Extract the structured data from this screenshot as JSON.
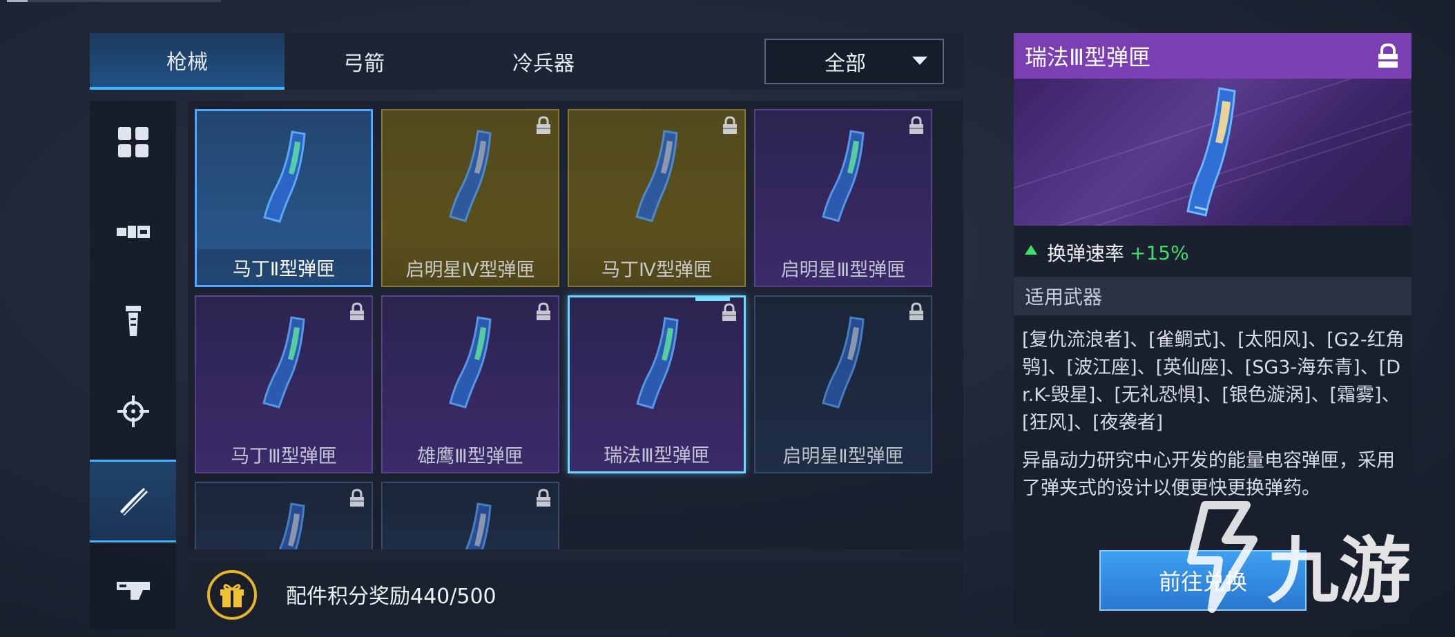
{
  "tabs": [
    {
      "label": "枪械",
      "active": true
    },
    {
      "label": "弓箭",
      "active": false
    },
    {
      "label": "冷兵器",
      "active": false
    }
  ],
  "filter": {
    "selected": "全部"
  },
  "sidebar": {
    "items": [
      {
        "icon": "grid-all-icon",
        "active": false
      },
      {
        "icon": "muzzle-icon",
        "active": false
      },
      {
        "icon": "grip-icon",
        "active": false
      },
      {
        "icon": "crosshair-scope-icon",
        "active": false
      },
      {
        "icon": "magazine-icon",
        "active": true
      },
      {
        "icon": "stock-icon",
        "active": false
      }
    ]
  },
  "grid": {
    "cards": [
      {
        "name": "马丁Ⅱ型弹匣",
        "rarity": "blue",
        "locked": false,
        "selected": false
      },
      {
        "name": "启明星Ⅳ型弹匣",
        "rarity": "gold",
        "locked": true,
        "selected": false
      },
      {
        "name": "马丁Ⅳ型弹匣",
        "rarity": "gold",
        "locked": true,
        "selected": false
      },
      {
        "name": "启明星Ⅲ型弹匣",
        "rarity": "purple",
        "locked": true,
        "selected": false
      },
      {
        "name": "马丁Ⅲ型弹匣",
        "rarity": "purple",
        "locked": true,
        "selected": false
      },
      {
        "name": "雄鹰Ⅲ型弹匣",
        "rarity": "purple",
        "locked": true,
        "selected": false
      },
      {
        "name": "瑞法Ⅲ型弹匣",
        "rarity": "purple",
        "locked": true,
        "selected": true
      },
      {
        "name": "启明星Ⅱ型弹匣",
        "rarity": "navy",
        "locked": true,
        "selected": false
      },
      {
        "name": "",
        "rarity": "navy",
        "locked": true,
        "selected": false
      },
      {
        "name": "",
        "rarity": "navy",
        "locked": true,
        "selected": false
      }
    ]
  },
  "reward": {
    "text": "配件积分奖励440/500"
  },
  "detail": {
    "title": "瑞法Ⅲ型弹匣",
    "locked": true,
    "stat_label": "换弹速率",
    "stat_value": "+15%",
    "section_title": "适用武器",
    "weapons": "[复仇流浪者]、[雀鲷式]、[太阳风]、[G2-红角鸮]、[波江座]、[英仙座]、[SG3-海东青]、[Dr.K-毁星]、[无礼恐惧]、[银色漩涡]、[霜雾]、[狂风]、[夜袭者]",
    "description": "异晶动力研究中心开发的能量电容弹匣，采用了弹夹式的设计以便更快更换弹药。",
    "button": "前往兑换"
  },
  "watermark": {
    "text": "九游"
  },
  "colors": {
    "accent_blue": "#47b4ff",
    "rarity_purple": "#7c3fb3",
    "stat_green": "#3be06a",
    "gift_gold": "#e5b52e"
  }
}
